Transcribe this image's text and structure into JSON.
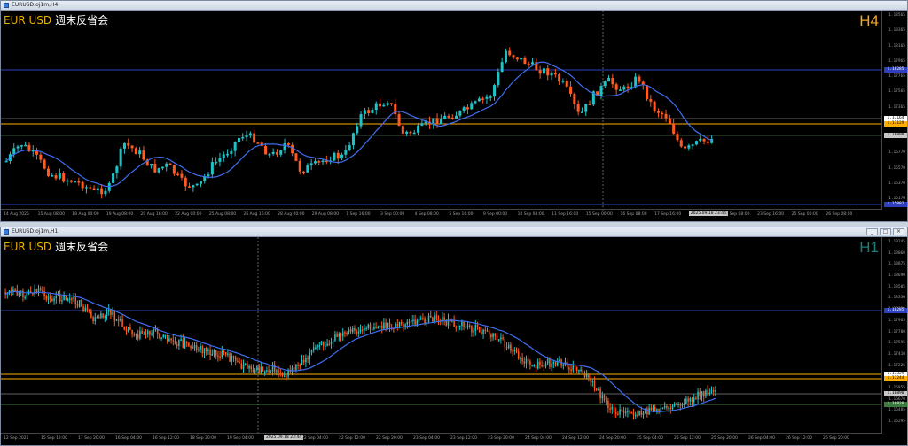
{
  "colors": {
    "bull": "#1fc3c7",
    "bear": "#ff5a1f",
    "ma": "#3f6ff0",
    "hline_blue": "#2e3fc2",
    "hline_orange": "#ffae00",
    "hline_gray": "#5f5f5f",
    "hline_green": "#3d7a3d",
    "tf_h4": "#f5a623",
    "tf_h1": "#1d7e7e"
  },
  "window_h4": {
    "title": "EURUSD.oj1m,H4",
    "symbol": "EUR USD",
    "subtitle": "週末反省会",
    "timeframe": "H4",
    "price_labels": [
      "1.18565",
      "1.18365",
      "1.18165",
      "1.17965",
      "1.17765",
      "1.17565",
      "1.17365",
      "1.17165",
      "1.16965",
      "1.16770",
      "1.16570",
      "1.16370",
      "1.16170"
    ],
    "price_boxes": [
      {
        "value": "1.18285",
        "color": "#2e3fc2",
        "text": "#ffffff"
      },
      {
        "value": "1.17164",
        "color": "#ffffff",
        "text": "#000000"
      },
      {
        "value": "1.17129",
        "color": "#ffae00",
        "text": "#000000"
      },
      {
        "value": "1.16890",
        "color": "#c8c8c8",
        "text": "#000000"
      },
      {
        "value": "1.15882",
        "color": "#2e3fc2",
        "text": "#ffffff"
      }
    ],
    "time_labels": [
      "14 Aug 2025",
      "15 Aug 08:00",
      "18 Aug 00:00",
      "19 Aug 08:00",
      "20 Aug 16:00",
      "22 Aug 00:00",
      "25 Aug 08:00",
      "26 Aug 16:00",
      "28 Aug 00:00",
      "29 Aug 08:00",
      "1 Sep 16:00",
      "3 Sep 00:00",
      "4 Sep 08:00",
      "5 Sep 16:00",
      "9 Sep 00:00",
      "10 Sep 08:00",
      "11 Sep 16:00",
      "15 Sep 00:00",
      "16 Sep 08:00",
      "17 Sep 16:00",
      "2025.09.18 23:44",
      "22 Sep 08:00",
      "23 Sep 16:00",
      "25 Sep 00:00",
      "26 Sep 08:00"
    ],
    "time_highlight": "2025.09.18 23:44"
  },
  "window_h1": {
    "title": "EURUSD.oj1m,H1",
    "symbol": "EUR USD",
    "subtitle": "週末反省会",
    "timeframe": "H1",
    "price_labels": [
      "1.19245",
      "1.19060",
      "1.18875",
      "1.18690",
      "1.18505",
      "1.18330",
      "1.18150",
      "1.17965",
      "1.17780",
      "1.17595",
      "1.17410",
      "1.17225",
      "1.17040",
      "1.16855",
      "1.16670",
      "1.16485",
      "1.16295"
    ],
    "price_boxes": [
      {
        "value": "1.18285",
        "color": "#2e3fc2",
        "text": "#ffffff"
      },
      {
        "value": "1.17329",
        "color": "#ffffff",
        "text": "#000000"
      },
      {
        "value": "1.17244",
        "color": "#ffae00",
        "text": "#000000"
      },
      {
        "value": "1.16890",
        "color": "#c8c8c8",
        "text": "#000000"
      },
      {
        "value": "1.16820",
        "color": "#3d7a3d",
        "text": "#ffffff"
      }
    ],
    "time_labels": [
      "12 Sep 2025",
      "15 Sep 12:00",
      "17 Sep 20:00",
      "16 Sep 04:00",
      "16 Sep 12:00",
      "18 Sep 20:00",
      "19 Sep 04:00",
      "2025.09.18 23:44",
      "22 Sep 04:00",
      "22 Sep 12:00",
      "22 Sep 20:00",
      "23 Sep 04:00",
      "23 Sep 12:00",
      "23 Sep 20:00",
      "24 Sep 04:00",
      "24 Sep 12:00",
      "24 Sep 20:00",
      "25 Sep 04:00",
      "25 Sep 12:00",
      "25 Sep 20:00",
      "26 Sep 04:00",
      "26 Sep 12:00",
      "26 Sep 20:00"
    ],
    "time_highlight": "2025.09.18 23:44"
  },
  "win_buttons": [
    "_",
    "□",
    "×"
  ]
}
